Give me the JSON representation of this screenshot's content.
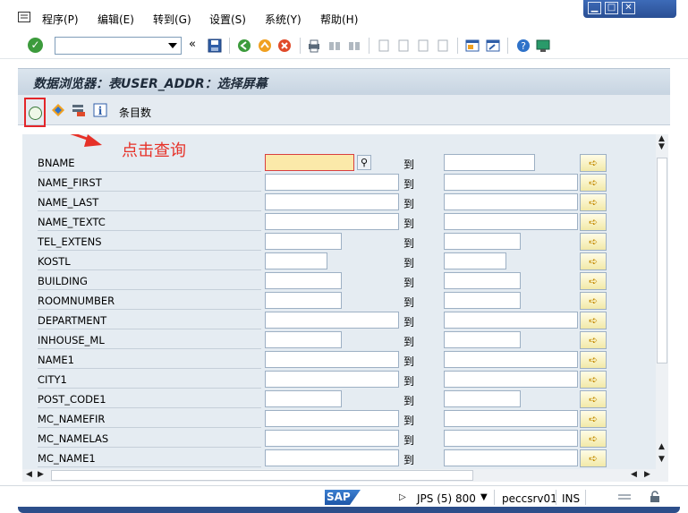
{
  "menu": {
    "items": [
      "程序(P)",
      "编辑(E)",
      "转到(G)",
      "设置(S)",
      "系统(Y)",
      "帮助(H)"
    ]
  },
  "window": {
    "minimize": "▁",
    "maximize": "□",
    "close": "✕"
  },
  "toolbar": {
    "command_value": "",
    "back_label": "«"
  },
  "title": "数据浏览器：表USER_ADDR：选择屏幕",
  "app_toolbar": {
    "entries_label": "条目数"
  },
  "annotation": {
    "text": "点击查询"
  },
  "selection": {
    "to_label": "到",
    "rows": [
      {
        "label": "BNAME"
      },
      {
        "label": "NAME_FIRST"
      },
      {
        "label": "NAME_LAST"
      },
      {
        "label": "NAME_TEXTC"
      },
      {
        "label": "TEL_EXTENS"
      },
      {
        "label": "KOSTL"
      },
      {
        "label": "BUILDING"
      },
      {
        "label": "ROOMNUMBER"
      },
      {
        "label": "DEPARTMENT"
      },
      {
        "label": "INHOUSE_ML"
      },
      {
        "label": "NAME1"
      },
      {
        "label": "CITY1"
      },
      {
        "label": "POST_CODE1"
      },
      {
        "label": "MC_NAMEFIR"
      },
      {
        "label": "MC_NAMELAS"
      },
      {
        "label": "MC_NAME1"
      }
    ]
  },
  "status": {
    "system": "JPS (5) 800",
    "server": "peccsrv01",
    "mode": "INS",
    "logo": "SAP"
  },
  "colors": {
    "title_bg": "#c7d4e1",
    "selection_bg": "#e5ecf2",
    "active_field": "#fbe9a9",
    "annotation": "#e63128"
  }
}
